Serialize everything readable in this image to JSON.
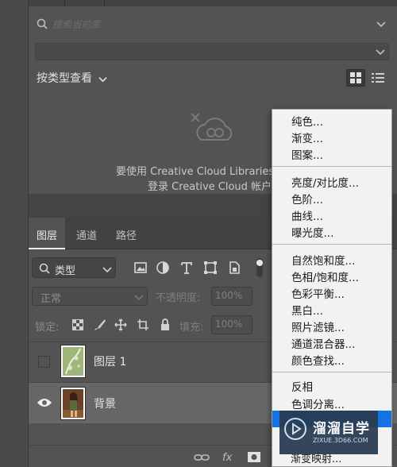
{
  "libraries": {
    "search_placeholder": "搜索当前库",
    "view_by_type": "按类型查看",
    "message_line1": "要使用 Creative Cloud Libraries，",
    "message_line2": "登录 Creative Cloud 帐户"
  },
  "layers_panel": {
    "tabs": [
      {
        "label": "图层",
        "active": true
      },
      {
        "label": "通道",
        "active": false
      },
      {
        "label": "路径",
        "active": false
      }
    ],
    "filter_kind": "类型",
    "blend_mode": "正常",
    "opacity_label": "不透明度:",
    "opacity_value": "100%",
    "lock_label": "锁定:",
    "fill_label": "填充:",
    "fill_value": "100%",
    "layers": [
      {
        "name": "图层 1",
        "visible": false,
        "selected": false
      },
      {
        "name": "背景",
        "visible": true,
        "selected": true
      }
    ],
    "bottom_icons": [
      "link-icon",
      "fx-icon",
      "mask-icon"
    ],
    "bottom_fx": "fx"
  },
  "adjustment_menu": {
    "groups": [
      [
        "纯色...",
        "渐变...",
        "图案..."
      ],
      [
        "亮度/对比度...",
        "色阶...",
        "曲线...",
        "曝光度..."
      ],
      [
        "自然饱和度...",
        "色相/饱和度...",
        "色彩平衡...",
        "黑白...",
        "照片滤镜...",
        "通道混合器...",
        "颜色查找..."
      ],
      [
        "反相",
        "色调分离..."
      ]
    ],
    "partial_item": "渐变映射..."
  },
  "watermark": {
    "title": "溜溜自学",
    "subtitle": "ZIXUE.3D66.COM"
  },
  "colors": {
    "panel_bg": "#535353",
    "selected_layer_bg": "#666666",
    "menu_bg": "#f2f2f2",
    "menu_highlight": "#1472e4"
  }
}
